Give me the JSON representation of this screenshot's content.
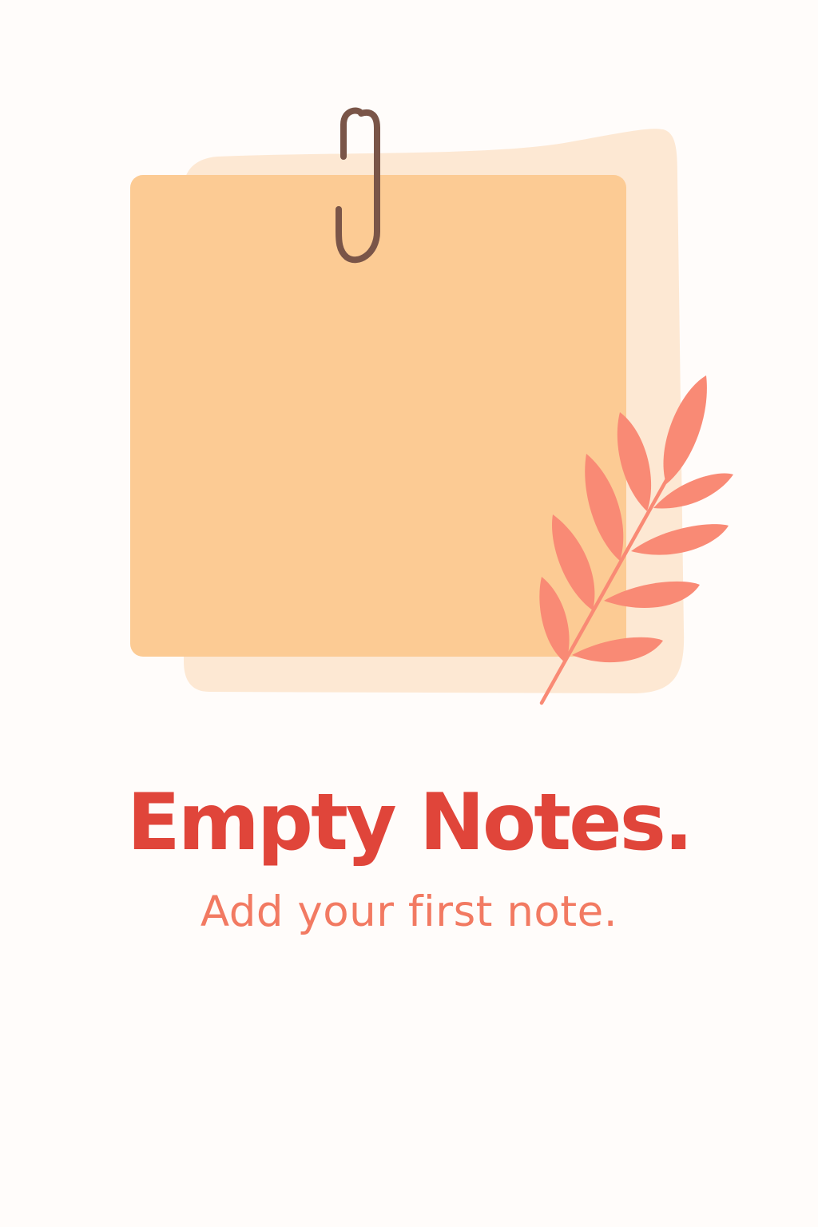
{
  "empty_state": {
    "title": "Empty Notes.",
    "subtitle": "Add your first note."
  },
  "illustration": {
    "icons": [
      "sticky-note-icon",
      "paperclip-icon",
      "leaf-branch-icon"
    ]
  },
  "colors": {
    "background": "#FFFCFA",
    "note_front": "#FCCB94",
    "note_back": "#FDE8D3",
    "paperclip": "#7A5548",
    "leaf": "#F98A75",
    "title": "#E0453A",
    "subtitle": "#F27A62"
  }
}
